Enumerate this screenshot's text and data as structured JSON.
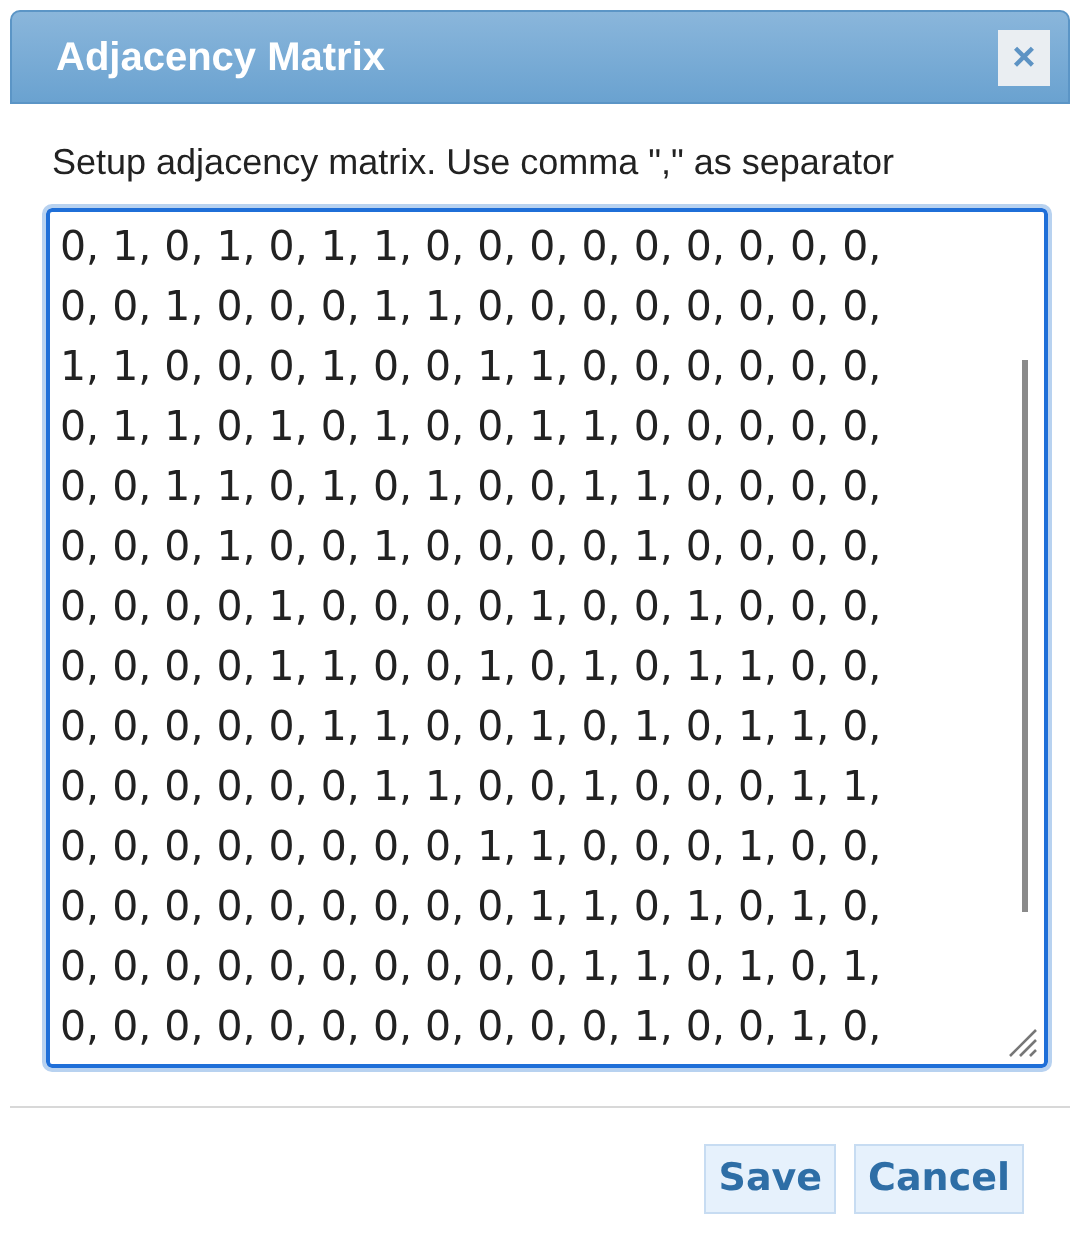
{
  "dialog": {
    "title": "Adjacency Matrix",
    "close_label": "×"
  },
  "instruction": "Setup adjacency matrix. Use comma \",\" as separator",
  "matrix_lines": [
    "0, 1, 0, 1, 0, 1, 1, 0, 0, 0, 0, 0, 0, 0, 0, 0,",
    "0, 0, 1, 0, 0, 0, 1, 1, 0, 0, 0, 0, 0, 0, 0, 0,",
    "1, 1, 0, 0, 0, 1, 0, 0, 1, 1, 0, 0, 0, 0, 0, 0,",
    "0, 1, 1, 0, 1, 0, 1, 0, 0, 1, 1, 0, 0, 0, 0, 0,",
    "0, 0, 1, 1, 0, 1, 0, 1, 0, 0, 1, 1, 0, 0, 0, 0,",
    "0, 0, 0, 1, 0, 0, 1, 0, 0, 0, 0, 1, 0, 0, 0, 0,",
    "0, 0, 0, 0, 1, 0, 0, 0, 0, 1, 0, 0, 1, 0, 0, 0,",
    "0, 0, 0, 0, 1, 1, 0, 0, 1, 0, 1, 0, 1, 1, 0, 0,",
    "0, 0, 0, 0, 0, 1, 1, 0, 0, 1, 0, 1, 0, 1, 1, 0,",
    "0, 0, 0, 0, 0, 0, 1, 1, 0, 0, 1, 0, 0, 0, 1, 1,",
    "0, 0, 0, 0, 0, 0, 0, 0, 1, 1, 0, 0, 0, 1, 0, 0,",
    "0, 0, 0, 0, 0, 0, 0, 0, 0, 1, 1, 0, 1, 0, 1, 0,",
    "0, 0, 0, 0, 0, 0, 0, 0, 0, 0, 1, 1, 0, 1, 0, 1,",
    "0, 0, 0, 0, 0, 0, 0, 0, 0, 0, 0, 1, 0, 0, 1, 0,"
  ],
  "buttons": [
    "Save",
    "Cancel"
  ]
}
